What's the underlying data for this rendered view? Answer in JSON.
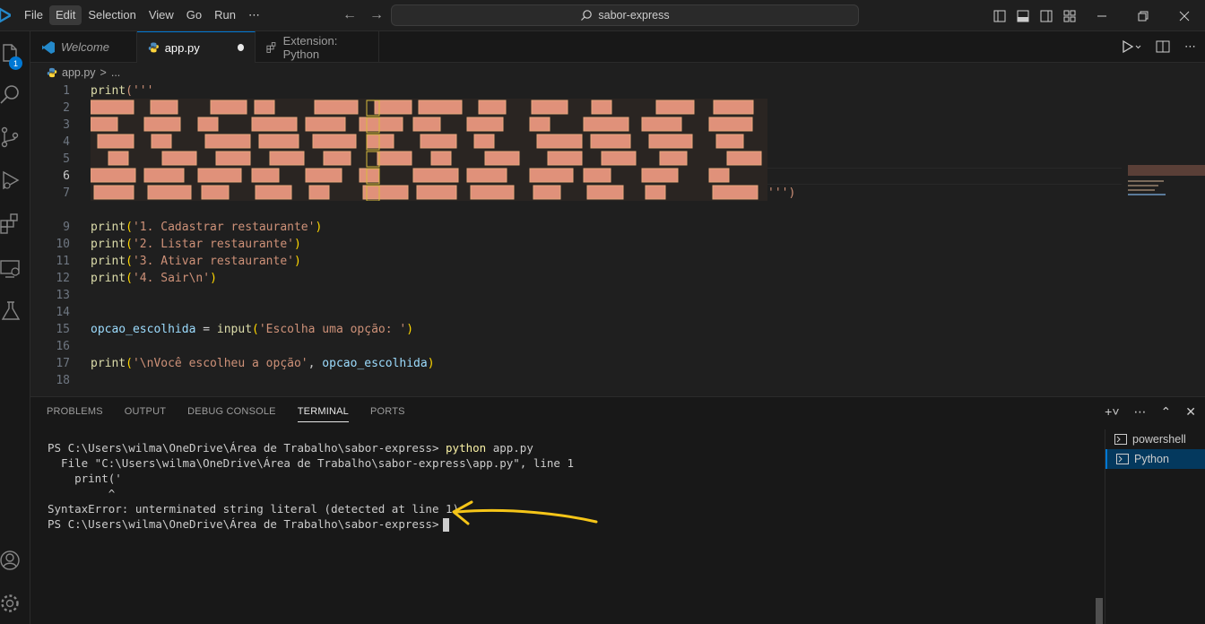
{
  "menu": [
    "File",
    "Edit",
    "Selection",
    "View",
    "Go",
    "Run",
    "⋯"
  ],
  "search": {
    "text": "sabor-express"
  },
  "activity": {
    "explorer_badge": "1"
  },
  "tabs": [
    {
      "label": "Welcome"
    },
    {
      "label": "app.py"
    },
    {
      "label": "Extension: Python"
    }
  ],
  "breadcrumb": {
    "file": "app.py",
    "sep": ">",
    "symbol": "..."
  },
  "editor": {
    "line_numbers": [
      "1",
      "2",
      "3",
      "4",
      "5",
      "6",
      "7",
      "",
      "9",
      "10",
      "11",
      "12",
      "13",
      "14",
      "15",
      "16",
      "17",
      "18"
    ],
    "current_line": "6",
    "l1_fn": "print",
    "l1_rest": "('''",
    "l7_tail": "''')",
    "l9_fn": "print",
    "l9_str": "'1. Cadastrar restaurante'",
    "l10_fn": "print",
    "l10_str": "'2. Listar restaurante'",
    "l11_fn": "print",
    "l11_str": "'3. Ativar restaurante'",
    "l12_fn": "print",
    "l12_str": "'4. Sair\\n'",
    "l15_var": "opcao_escolhida",
    "l15_eq": " = ",
    "l15_fn": "input",
    "l15_str": "'Escolha uma opção: '",
    "l17_fn": "print",
    "l17_str": "'\\nVocê escolheu a opção'",
    "l17_comma": ", ",
    "l17_var": "opcao_escolhida"
  },
  "panel": {
    "tabs": [
      "PROBLEMS",
      "OUTPUT",
      "DEBUG CONSOLE",
      "TERMINAL",
      "PORTS"
    ],
    "active_tab": "TERMINAL",
    "terminal": {
      "prompt1": "PS C:\\Users\\wilma\\OneDrive\\Área de Trabalho\\sabor-express> ",
      "cmd1_name": "python",
      "cmd1_arg": " app.py",
      "out1": "  File \"C:\\Users\\wilma\\OneDrive\\Área de Trabalho\\sabor-express\\app.py\", line 1",
      "out2": "    print('",
      "out3": "         ^",
      "out4": "SyntaxError: unterminated string literal (detected at line 1)",
      "prompt2": "PS C:\\Users\\wilma\\OneDrive\\Área de Trabalho\\sabor-express>"
    },
    "terminals": [
      "powershell",
      "Python"
    ]
  },
  "colors": {
    "accent": "#0078d4",
    "ascii_fill": "#e0917a",
    "ascii_outline": "#e8a87c",
    "annotation": "#f5c518"
  },
  "icons": [
    "vscode-icon",
    "files-icon",
    "search-icon",
    "source-control-icon",
    "run-debug-icon",
    "extensions-icon",
    "remote-explorer-icon",
    "testing-icon",
    "account-icon",
    "settings-gear-icon",
    "python-icon",
    "run-icon",
    "split-editor-icon",
    "more-icon",
    "add-terminal-icon",
    "chevron-up-icon",
    "close-icon",
    "terminal-icon"
  ]
}
